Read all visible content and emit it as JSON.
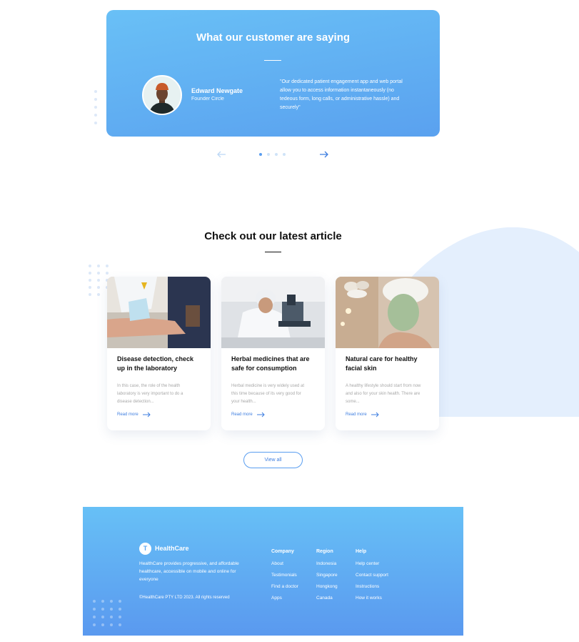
{
  "testimonial": {
    "title": "What our customer are saying",
    "name": "Edward Newgate",
    "role": "Founder Circle",
    "quote": "\"Our dedicated patient engagement app and web portal allow you to access information instantaneously (no tedeous form, long calls, or administrative hassle) and securely\"",
    "slides": 4,
    "active_slide": 1
  },
  "articles": {
    "title": "Check out our latest article",
    "items": [
      {
        "title": "Disease detection, check up in the laboratory",
        "excerpt": "In this case, the role of the health laboratory is very important to do a disease detection...",
        "link": "Read more"
      },
      {
        "title": "Herbal medicines that are safe for consumption",
        "excerpt": "Herbal medicine is very widely used at this time because of its very good for your health...",
        "link": "Read more"
      },
      {
        "title": "Natural care for healthy facial skin",
        "excerpt": "A healthy lifestyle should start from now and also for your skin health. There are some...",
        "link": "Read more"
      }
    ],
    "view_all": "View all"
  },
  "footer": {
    "brand_initial": "T",
    "brand_name": "HealthCare",
    "description": "HealthCare provides progressive, and affordable healthcare, accessible on mobile and online for everyone",
    "copyright": "©HealthCare PTY LTD 2023. All rights reserved",
    "columns": [
      {
        "heading": "Company",
        "links": [
          "About",
          "Testimonials",
          "Find a doctor",
          "Apps"
        ]
      },
      {
        "heading": "Region",
        "links": [
          "Indonesia",
          "Singapore",
          "Hongkong",
          "Canada"
        ]
      },
      {
        "heading": "Help",
        "links": [
          "Help center",
          "Contact support",
          "Instructions",
          "How it works"
        ]
      }
    ]
  },
  "colors": {
    "accent": "#5a9ef0",
    "link": "#3f7fe0",
    "gradient_start": "#69c0f6",
    "gradient_end": "#5a99ef",
    "blob": "#e4effd"
  },
  "icons": {
    "prev": "arrow-left-icon",
    "next": "arrow-right-icon",
    "read_more": "arrow-right-icon"
  }
}
